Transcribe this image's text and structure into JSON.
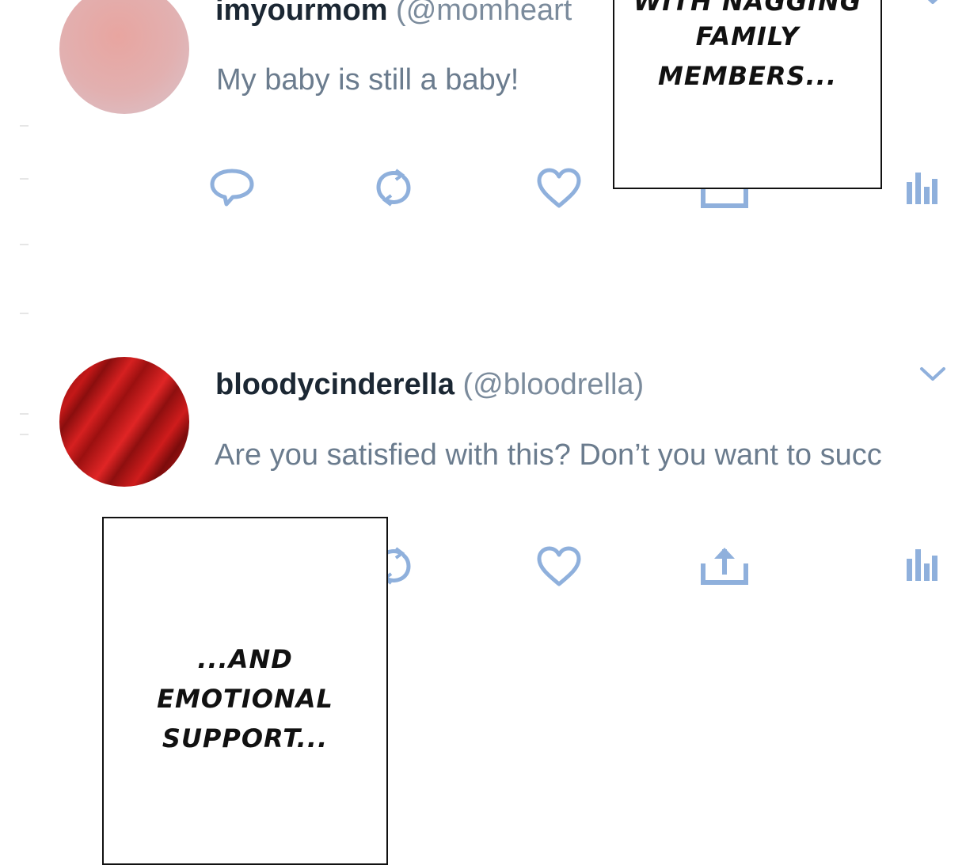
{
  "posts": [
    {
      "username": "imyourmom",
      "handle": "(@momheart",
      "text": "My baby is still a baby!",
      "avatar_color": "#e3aca8"
    },
    {
      "username": "bloodycinderella",
      "handle": "(@bloodrella)",
      "text": "Are you satisfied with this? Don’t you want to succ",
      "avatar_color": "#c41818"
    }
  ],
  "caption_top": {
    "line1": "WITH NAGGING",
    "line2": "FAMILY",
    "line3": "MEMBERS..."
  },
  "caption_bottom": {
    "line1": "...AND",
    "line2": "EMOTIONAL",
    "line3": "SUPPORT..."
  },
  "colors": {
    "icon_blue": "#8fb0dc",
    "text_dark": "#1b2733",
    "text_muted": "#6b7c8e"
  },
  "icons": [
    "reply-icon",
    "retweet-icon",
    "like-icon",
    "share-icon",
    "stats-icon",
    "chevron-down-icon"
  ]
}
